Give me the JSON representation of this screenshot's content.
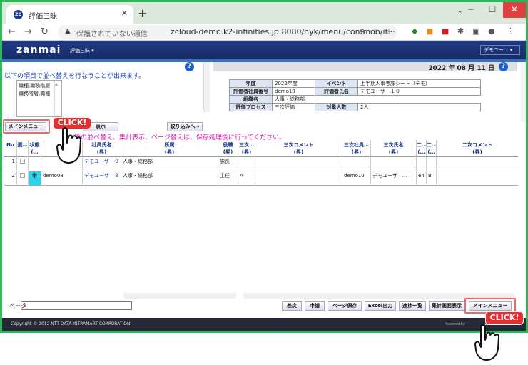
{
  "browser": {
    "tab_title": "評価三昧",
    "favicon": "ZC",
    "url_warning": "保護されていない通信",
    "url": "zcloud-demo.k2-infinities.jp:8080/hyk/menu/common/if···"
  },
  "app": {
    "logo": "zanmai",
    "menu": "評価三昧 ▾",
    "user_menu": "デモユー... ▾"
  },
  "left_pane": {
    "sort_message": "以下の項目で並べ替えを行なうことが出来ます。",
    "sort_items": [
      "職種,職務階層",
      "職務階層,職種"
    ]
  },
  "right_pane": {
    "date": "2022 年 08 月 11 日",
    "info": [
      {
        "label1": "年度",
        "value1": "2022年度",
        "label2": "イベント",
        "value2": "上半期人事考課シート（デモ）"
      },
      {
        "label1": "評価者社員番号",
        "value1": "demo10",
        "label2": "評価者氏名",
        "value2": "デモユーザ　１０"
      },
      {
        "label1": "組織名",
        "value1": "人事・総務部",
        "label2": "",
        "value2": ""
      },
      {
        "label1": "評価プロセス",
        "value1": "三次評価",
        "label2": "対象人数",
        "value2": "2人"
      }
    ]
  },
  "buttons": {
    "main_menu": "メインメニュー",
    "display": "表示",
    "filter": "絞り込みへ→",
    "remand": "差戻",
    "apply": "申請",
    "save_page": "ページ保存",
    "excel": "Excel出力",
    "progress": "進捗一覧",
    "aggregate": "集計画面表示",
    "main_menu_bottom": "メインメニュー"
  },
  "callouts": {
    "click": "CLICK!"
  },
  "warning_message": "…後の並べ替え、集計表示、ページ替えは、保存処理後に行ってください。",
  "grid": {
    "headers": [
      "No",
      "選…",
      "状態\n(…",
      "",
      "社員氏名\n(昇)",
      "所属\n(昇)",
      "役職\n(昇)",
      "三次…\n(昇)",
      "三次コメント\n(昇)",
      "三次社員…\n(昇)",
      "三次氏名\n(昇)",
      "二…\n(…",
      "二…\n(…",
      "二次コメント\n(昇)"
    ],
    "rows": [
      {
        "no": "1",
        "status": "",
        "id": "",
        "name": "デモユーザ　９",
        "dept": "人事・総務部",
        "post": "課長",
        "grade3": "",
        "comment3": "",
        "emp3": "",
        "name3": "",
        "c1": "",
        "c2": "",
        "comment2": ""
      },
      {
        "no": "2",
        "status": "申",
        "id": "demo08",
        "name": "デモユーザ　８",
        "dept": "人事・総務部",
        "post": "主任",
        "grade3": "A",
        "comment3": "",
        "emp3": "demo10",
        "name3": "デモユーザ　…",
        "c1": "64",
        "c2": "B",
        "comment2": ""
      }
    ]
  },
  "pager": {
    "label": "ページ",
    "value": "1"
  },
  "footer": {
    "copyright": "Copyright © 2012 NTT DATA INTRAMART CORPORATION",
    "powered": "Powered by",
    "brand": "…-mart"
  },
  "colors": {
    "accent": "#2eb85c",
    "header": "#1b3275",
    "callout": "#e53030"
  }
}
